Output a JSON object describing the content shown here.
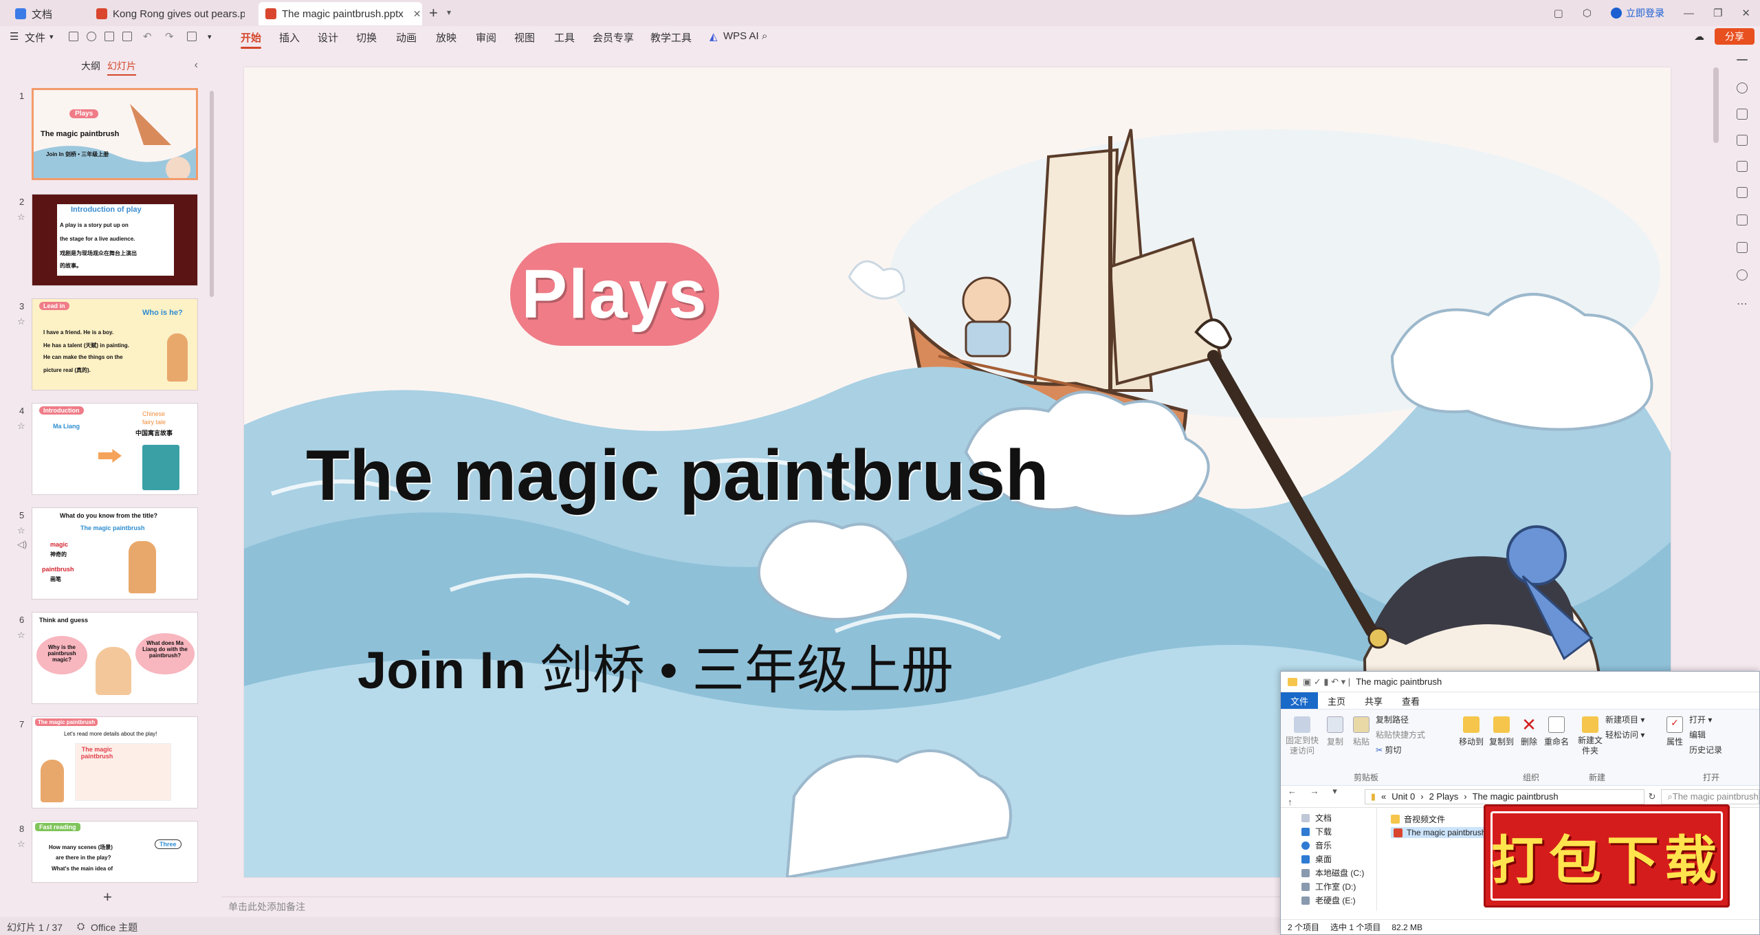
{
  "titlebar": {
    "tabs": [
      {
        "label": "文档",
        "active": false
      },
      {
        "label": "Kong Rong gives out pears.pptx",
        "active": false
      },
      {
        "label": "The magic paintbrush.pptx",
        "active": true
      }
    ],
    "login_label": "立即登录"
  },
  "menubar": {
    "file_label": "文件",
    "items": [
      "开始",
      "插入",
      "设计",
      "切换",
      "动画",
      "放映",
      "审阅",
      "视图",
      "工具",
      "会员专享",
      "教学工具"
    ],
    "active": "开始",
    "wps_ai": "WPS AI",
    "share_label": "分享"
  },
  "left_panel": {
    "tabs": [
      "大纲",
      "幻灯片"
    ],
    "active_tab": "幻灯片",
    "thumbnails": [
      {
        "num": "1",
        "badge": "Plays",
        "title": "The magic paintbrush",
        "sub": "Join In 剑桥 • 三年级上册"
      },
      {
        "num": "2",
        "title": "Introduction of play",
        "line1": "A play is a story put up on",
        "line2": "the stage for a live audience.",
        "line3": "戏剧是为现场观众在舞台上演出",
        "line4": "的故事。"
      },
      {
        "num": "3",
        "badge": "Lead in",
        "title": "Who is he?",
        "line1": "I have a friend. He is a boy.",
        "line2": "He has a talent (天赋) in painting.",
        "line3": "He can make the things on the",
        "line4": "picture real (真的)."
      },
      {
        "num": "4",
        "badge": "Introduction",
        "name": "Ma Liang",
        "tag1": "Chinese",
        "tag2": "fairy tale",
        "tag3": "中国寓言故事"
      },
      {
        "num": "5",
        "title": "What do you know from the title?",
        "sub": "The magic paintbrush",
        "w1": "magic",
        "w1cn": "神奇的",
        "w2": "paintbrush",
        "w2cn": "画笔"
      },
      {
        "num": "6",
        "title": "Think and guess",
        "q1": "Why is the paintbrush magic?",
        "q2": "What does Ma Liang do with the paintbrush?"
      },
      {
        "num": "7",
        "badge": "The magic paintbrush",
        "title": "Let's read more details about the play!",
        "book": "The magic paintbrush"
      },
      {
        "num": "8",
        "badge": "Fast reading",
        "line1": "How many scenes (场景)",
        "line2": "are there in the play?",
        "line3": "What's the main idea of",
        "answer": "Three"
      }
    ],
    "add_label": "+"
  },
  "slide": {
    "pill": "Plays",
    "title": "The magic paintbrush",
    "subtitle_en": "Join In ",
    "subtitle_cn": "剑桥 • 三年级上册",
    "colors": {
      "pill": "#ef7c87",
      "wave": "#9cc8de",
      "boat": "#d98a5a"
    }
  },
  "notes_placeholder": "单击此处添加备注",
  "statusbar": {
    "slide_count": "幻灯片 1 / 37",
    "theme": "Office 主题"
  },
  "explorer": {
    "title": "The magic paintbrush",
    "tabs": [
      "文件",
      "主页",
      "共享",
      "查看"
    ],
    "ribbon": {
      "pin": "固定到快速访问",
      "copy": "复制",
      "paste": "粘贴",
      "copy_path": "复制路径",
      "paste_shortcut": "粘贴快捷方式",
      "cut": "剪切",
      "move_to": "移动到",
      "copy_to": "复制到",
      "delete": "删除",
      "rename": "重命名",
      "new_folder": "新建文件夹",
      "new_item": "新建项目",
      "easy_access": "轻松访问",
      "properties": "属性",
      "open": "打开",
      "edit": "编辑",
      "history": "历史记录",
      "group_clipboard": "剪贴板",
      "group_organize": "组织",
      "group_new": "新建",
      "group_open": "打开"
    },
    "path": [
      "Unit 0",
      "2 Plays",
      "The magic paintbrush"
    ],
    "search_placeholder": "The magic paintbrush",
    "nav": [
      "文档",
      "下载",
      "音乐",
      "桌面",
      "本地磁盘 (C:)",
      "工作室 (D:)",
      "老硬盘 (E:)"
    ],
    "files": [
      "音视频文件",
      "The magic paintbrush"
    ],
    "status": {
      "count": "2 个项目",
      "selected": "选中 1 个项目",
      "size": "82.2 MB"
    }
  },
  "stamp": {
    "text": "打包下载"
  }
}
